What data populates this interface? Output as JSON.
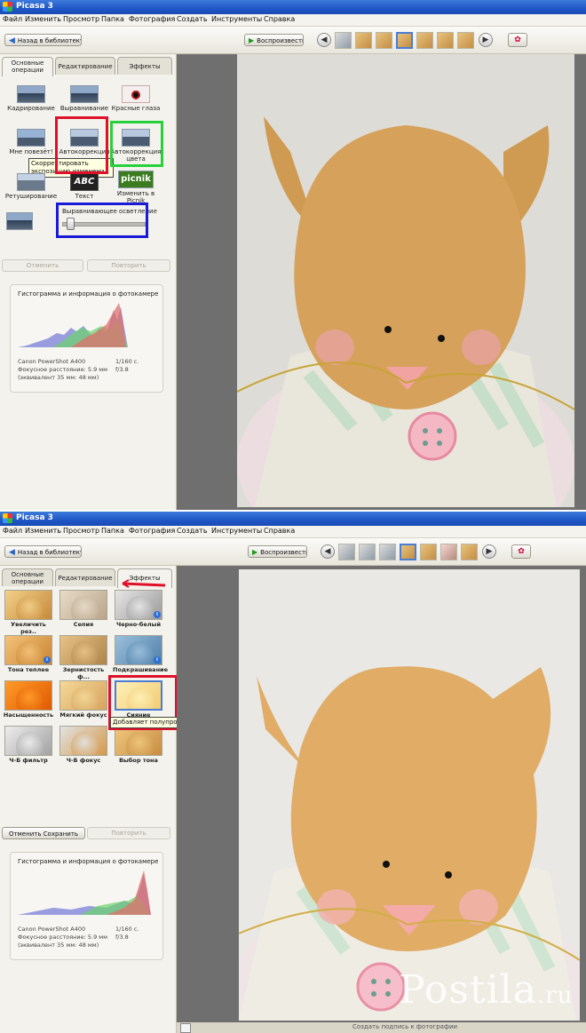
{
  "window1": {
    "title": "Picasa 3",
    "menu": [
      "Файл",
      "Изменить",
      "Просмотр",
      "Папка",
      "Фотография",
      "Создать",
      "Инструменты",
      "Справка"
    ],
    "back_label": "Назад в библиотеку",
    "play_label": "Воспроизвести",
    "tabs": [
      "Основные операции",
      "Редактирование",
      "Эффекты"
    ],
    "tools": [
      {
        "label": "Кадрирование",
        "icon": "crop-icon"
      },
      {
        "label": "Выравнивание",
        "icon": "straighten-icon"
      },
      {
        "label": "Красные глаза",
        "icon": "red-eye-icon"
      },
      {
        "label": "Мне повезёт!",
        "icon": "lucky-icon"
      },
      {
        "label": "Автокоррекция",
        "icon": "auto-contrast-icon"
      },
      {
        "label": "Автокоррекция цвета",
        "icon": "auto-color-icon"
      },
      {
        "label": "Ретуширование",
        "icon": "retouch-icon"
      },
      {
        "label": "Текст",
        "icon": "text-icon"
      },
      {
        "label": "Изменить в Picnik",
        "icon": "picnik-icon"
      }
    ],
    "text_icon_label": "ABC",
    "picnik_icon_label": "picnik",
    "tooltip": "Скорректировать экспозицию изменени",
    "fill_light_label": "Выравнивающее осветление",
    "fill_light_value": 0.05,
    "undo_label": "Отменить",
    "redo_label": "Повторить",
    "histogram_title": "Гистограмма и информация о фотокамере",
    "camera": "Canon PowerShot A400",
    "shutter": "1/160 с.",
    "focal": "Фокусное расстояние: 5.9 мм",
    "aperture": "f/3.8",
    "equiv": "(эквивалент 35 мм: 48 мм)"
  },
  "window2": {
    "title": "Picasa 3",
    "menu": [
      "Файл",
      "Изменить",
      "Просмотр",
      "Папка",
      "Фотография",
      "Создать",
      "Инструменты",
      "Справка"
    ],
    "back_label": "Назад в библиотеку",
    "play_label": "Воспроизвести",
    "tabs": [
      "Основные операции",
      "Редактирование",
      "Эффекты"
    ],
    "effects": [
      {
        "label": "Увеличить рез..",
        "tone": "warm"
      },
      {
        "label": "Сепия",
        "tone": "sepia"
      },
      {
        "label": "Черно-белый",
        "tone": "bw"
      },
      {
        "label": "Тона теплее",
        "tone": "warmer"
      },
      {
        "label": "Зернистость ф...",
        "tone": "grain"
      },
      {
        "label": "Подкрашивание",
        "tone": "tint"
      },
      {
        "label": "Насыщенность",
        "tone": "saturated"
      },
      {
        "label": "Мягкий фокус",
        "tone": "soft"
      },
      {
        "label": "Сияние",
        "tone": "glow"
      },
      {
        "label": "Ч-Б фильтр",
        "tone": "bwfilter"
      },
      {
        "label": "Ч-Б фокус",
        "tone": "bwfocus"
      },
      {
        "label": "Выбор тона",
        "tone": "pick"
      }
    ],
    "tooltip": "Добавляет полупрозрачное сияние",
    "undo_save_label": "Отменить Сохранить",
    "redo_label": "Повторить",
    "histogram_title": "Гистограмма и информация о фотокамере",
    "camera": "Canon PowerShot A400",
    "shutter": "1/160 с.",
    "focal": "Фокусное расстояние: 5.9 мм",
    "aperture": "f/3.8",
    "equiv": "(эквивалент 35 мм: 48 мм)",
    "caption_placeholder": "Создать подпись к фотографии"
  },
  "watermark": {
    "name": "Postila",
    "tld": ".ru"
  },
  "colors": {
    "annotation_red": "#e0102a",
    "annotation_green": "#27d13b",
    "annotation_blue": "#1a1ad8",
    "accent_blue": "#2a64c8"
  }
}
